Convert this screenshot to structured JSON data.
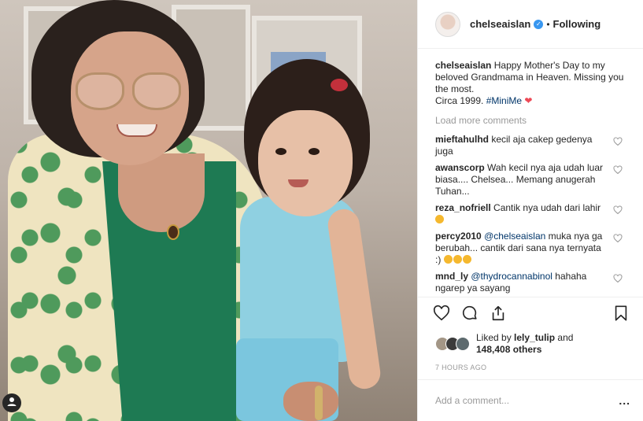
{
  "photo": {
    "alt_icon": "person-tag-icon"
  },
  "header": {
    "username": "chelseaislan",
    "verified_icon": "verified-badge-icon",
    "separator": "•",
    "follow_label": "Following"
  },
  "caption": {
    "username": "chelseaislan",
    "text": "Happy Mother's Day to my beloved Grandmama in Heaven. Missing you the most.",
    "line2": "Circa 1999.",
    "hashtag": "#MiniMe",
    "emoji": "red-heart"
  },
  "load_more": "Load more comments",
  "comments": [
    {
      "username": "mieftahulhd",
      "text": "kecil aja cakep gedenya juga"
    },
    {
      "username": "awanscorp",
      "text": "Wah kecil nya aja udah luar biasa.... Chelsea... Memang anugerah Tuhan..."
    },
    {
      "username": "reza_nofriell",
      "text": "Cantik nya udah dari lahir",
      "emoji": "grinning-face"
    },
    {
      "username": "percy2010",
      "mention": "@chelseaislan",
      "text": "muka nya ga berubah... cantik dari sana nya ternyata :)",
      "emoji": "smiling-faces"
    },
    {
      "username": "mnd_ly",
      "mention": "@thydrocannabinol",
      "text": "hahaha ngarep ya sayang"
    }
  ],
  "actions": {
    "like_icon": "heart-outline-icon",
    "comment_icon": "comment-icon",
    "share_icon": "share-icon",
    "save_icon": "bookmark-icon"
  },
  "likes": {
    "prefix": "Liked by",
    "user": "lely_tulip",
    "and": "and",
    "others": "148,408 others"
  },
  "timestamp": "7 HOURS AGO",
  "add_comment": {
    "placeholder": "Add a comment...",
    "more": "..."
  },
  "colors": {
    "link": "#003569",
    "muted": "#999999",
    "verified": "#3897f0",
    "heart": "#ed4956",
    "text": "#262626"
  }
}
